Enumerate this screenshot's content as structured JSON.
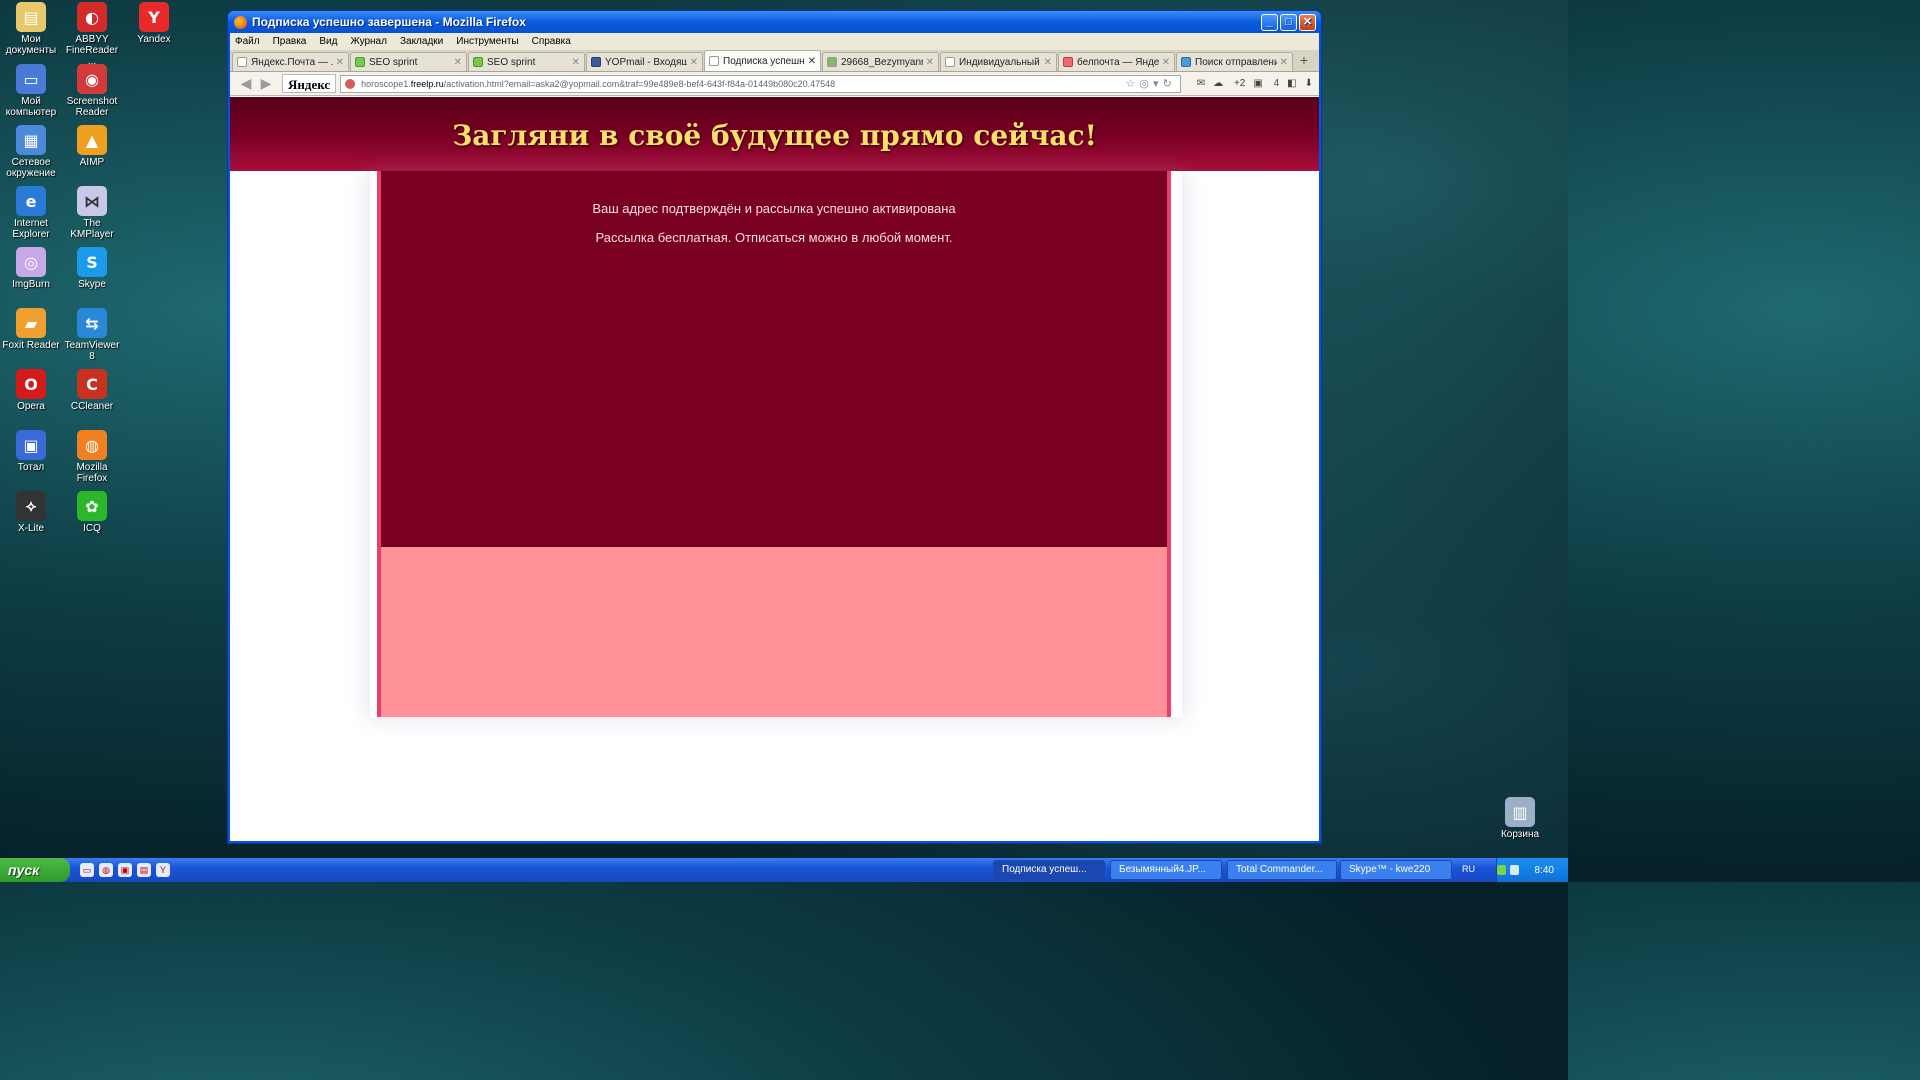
{
  "desktop": {
    "icons": [
      {
        "label": "Мои документы",
        "glyph": "▤",
        "color": "#e8c86a"
      },
      {
        "label": "ABBYY FineReader ...",
        "glyph": "◐",
        "color": "#d42a2a"
      },
      {
        "label": "Yandex",
        "glyph": "Y",
        "color": "#e82a2a"
      },
      {
        "label": "Мой компьютер",
        "glyph": "▭",
        "color": "#4a7ad8"
      },
      {
        "label": "Screenshot Reader",
        "glyph": "◉",
        "color": "#d43a3a"
      },
      {
        "label": "Сетевое окружение",
        "glyph": "▦",
        "color": "#4a8ad8"
      },
      {
        "label": "AIMP",
        "glyph": "▲",
        "color": "#f0a020"
      },
      {
        "label": "Internet Explorer",
        "glyph": "e",
        "color": "#2a7ad8"
      },
      {
        "label": "The KMPlayer",
        "glyph": "⋈",
        "color": "#c8c8e8"
      },
      {
        "label": "ImgBurn",
        "glyph": "◎",
        "color": "#c8a8e8"
      },
      {
        "label": "Skype",
        "glyph": "S",
        "color": "#1a9ae8"
      },
      {
        "label": "Foxit Reader",
        "glyph": "▰",
        "color": "#f0a030"
      },
      {
        "label": "TeamViewer 8",
        "glyph": "⇆",
        "color": "#2a88d8"
      },
      {
        "label": "Opera",
        "glyph": "O",
        "color": "#d41a1a"
      },
      {
        "label": "CCleaner",
        "glyph": "C",
        "color": "#c83020"
      },
      {
        "label": "Тотал",
        "glyph": "▣",
        "color": "#3a6ad8"
      },
      {
        "label": "Mozilla Firefox",
        "glyph": "◍",
        "color": "#f08020"
      },
      {
        "label": "X-Lite",
        "glyph": "⟡",
        "color": "#333333"
      },
      {
        "label": "ICQ",
        "glyph": "✿",
        "color": "#2ab82a"
      },
      {
        "label": "Корзина",
        "glyph": "▥",
        "color": "#9ab0c8"
      }
    ]
  },
  "window": {
    "title": "Подписка успешно завершена - Mozilla Firefox",
    "menu": [
      "Файл",
      "Правка",
      "Вид",
      "Журнал",
      "Закладки",
      "Инструменты",
      "Справка"
    ],
    "tabs": [
      {
        "label": "Яндекс.Почта — ...",
        "active": false
      },
      {
        "label": "SEO sprint",
        "active": false
      },
      {
        "label": "SEO sprint",
        "active": false
      },
      {
        "label": "YOPmail - Входящие",
        "active": false
      },
      {
        "label": "Подписка успешн...",
        "active": true
      },
      {
        "label": "29668_Bezymyann...",
        "active": false
      },
      {
        "label": "Индивидуальный ...",
        "active": false
      },
      {
        "label": "белпочта — Янде...",
        "active": false
      },
      {
        "label": "Поиск отправлений",
        "active": false
      }
    ],
    "yandex_logo": "Яндекс",
    "url": {
      "prefix": "horoscope1.",
      "domain": "freelp.ru",
      "path": "/activation.html?email=aska2@yopmail.com&traf=99e489e8-bef4-643f-f84a-01449b080c20.47548"
    },
    "toolbar_badges": {
      "cloud": "+2",
      "notes": "4"
    }
  },
  "page": {
    "headline": "Загляни в своё будущее прямо сейчас!",
    "line1": "Ваш адрес подтверждён и рассылка успешно активирована",
    "line2": "Рассылка бесплатная. Отписаться можно в любой момент.",
    "colors": {
      "header": "#7a0025",
      "headline": "#f8e06a",
      "panel": "#7a0022",
      "footer_panel": "#ff9199",
      "border": "#e8406a"
    }
  },
  "taskbar": {
    "start": "пуск",
    "items": [
      {
        "label": "Подписка успеш...",
        "active": true
      },
      {
        "label": "Безымянный4.JP...",
        "active": false
      },
      {
        "label": "Total Commander...",
        "active": false
      },
      {
        "label": "Skype™ - kwe220",
        "active": false
      }
    ],
    "lang": "RU",
    "clock": "8:40"
  }
}
